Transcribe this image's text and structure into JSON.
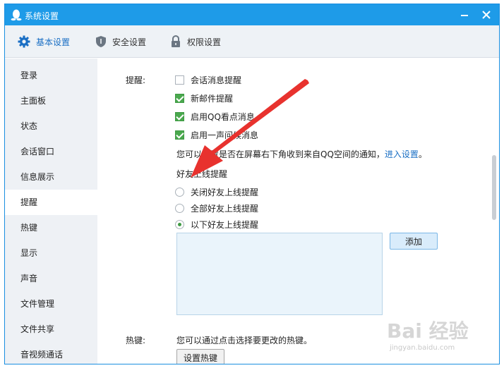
{
  "window": {
    "title": "系统设置"
  },
  "tabs": [
    {
      "label": "基本设置",
      "active": true
    },
    {
      "label": "安全设置"
    },
    {
      "label": "权限设置"
    }
  ],
  "sidebar": {
    "items": [
      {
        "label": "登录"
      },
      {
        "label": "主面板"
      },
      {
        "label": "状态"
      },
      {
        "label": "会话窗口"
      },
      {
        "label": "信息展示"
      },
      {
        "label": "提醒",
        "active": true
      },
      {
        "label": "热键"
      },
      {
        "label": "显示"
      },
      {
        "label": "声音"
      },
      {
        "label": "文件管理"
      },
      {
        "label": "文件共享"
      },
      {
        "label": "音视频通话"
      }
    ]
  },
  "reminder": {
    "section_label": "提醒:",
    "options": [
      {
        "label": "会话消息提醒",
        "checked": false
      },
      {
        "label": "新邮件提醒",
        "checked": true
      },
      {
        "label": "启用QQ看点消息",
        "checked": true
      },
      {
        "label": "启用一声问候消息",
        "checked": true
      }
    ],
    "notice_text": "您可以设置是否在屏幕右下角收到来自QQ空间的通知，",
    "notice_link": "进入设置",
    "notice_end": "。",
    "friend_online_label": "好友上线提醒",
    "radio_options": [
      {
        "label": "关闭好友上线提醒",
        "selected": false
      },
      {
        "label": "全部好友上线提醒",
        "selected": false
      },
      {
        "label": "以下好友上线提醒",
        "selected": true
      }
    ],
    "add_button": "添加"
  },
  "hotkey": {
    "section_label": "热键:",
    "description": "您可以通过点击选择要更改的热键。",
    "button": "设置热键"
  },
  "watermark": {
    "main": "Bai 经验",
    "sub": "jingyan.baidu.com"
  },
  "colors": {
    "titlebar": "#1e9be8",
    "accent": "#1a6fc4",
    "check": "#4aa84e",
    "arrow": "#e8322e"
  }
}
